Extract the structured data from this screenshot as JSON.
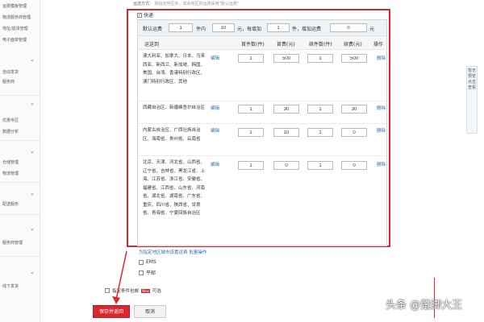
{
  "sidebar": {
    "items": [
      "运费模板管理",
      "物流服务商管理",
      "地址/退货管理",
      "电子面单管理",
      "自动发货",
      "服务商",
      "优惠专区",
      "数据分析",
      "仓储管理",
      "物流管理",
      "配送服务",
      "服务商管理",
      "线下发货"
    ]
  },
  "top": {
    "label": "运送方式：",
    "placeholder": "除指定地区外，其余地区的运费采用\"默认运费\""
  },
  "express": {
    "checkbox_mark": "✓",
    "label": "快递"
  },
  "default_row": {
    "label": "默认运费",
    "qty1": "1",
    "unit1": "件内",
    "fee1": "10",
    "unit2": "元，每增加",
    "qty2": "1",
    "unit3": "件，增加运费",
    "fee2": "0",
    "unit4": "元"
  },
  "table": {
    "headers": [
      "运送到",
      "首件数(件)",
      "首费(元)",
      "续件数(件)",
      "续费(元)",
      "操作"
    ],
    "edit_label": "编辑",
    "delete_label": "删除",
    "rows": [
      {
        "region": "澳大利亚、加拿大、日本、马来西亚、新西兰、新加坡、韩国、美国、台湾、香港特别行政区、澳门特别行政区、其他",
        "first": "1",
        "first_fee": "500",
        "next": "1",
        "next_fee": "500"
      },
      {
        "region": "西藏自治区、新疆维吾尔自治区",
        "first": "1",
        "first_fee": "30",
        "next": "1",
        "next_fee": "30"
      },
      {
        "region": "内蒙古自治区、广西壮族自治区、海南省、贵州省、云南省",
        "first": "1",
        "first_fee": "10",
        "next": "1",
        "next_fee": "0"
      },
      {
        "region": "北京、天津、河北省、山西省、辽宁省、吉林省、黑龙江省、上海、江苏省、浙江省、安徽省、福建省、江西省、山东省、河南省、湖北省、湖南省、广东省、重庆、四川省、陕西省、甘肃省、青海省、宁夏回族自治区",
        "first": "1",
        "first_fee": "0",
        "next": "1",
        "next_fee": "0"
      }
    ]
  },
  "batch_link": "为指定地区城市设置运费  批量操作",
  "options": [
    "EMS",
    "平邮"
  ],
  "free_condition": {
    "label": "指定条件包邮",
    "new_tag": "New",
    "suffix": "可选"
  },
  "buttons": {
    "save": "保存并返回",
    "cancel": "取消"
  },
  "right_panel": "暂无预览 点击查看",
  "watermark": "头条 @蹩脚大王",
  "colors": {
    "accent": "#d9272e",
    "link": "#2a6fb8"
  }
}
